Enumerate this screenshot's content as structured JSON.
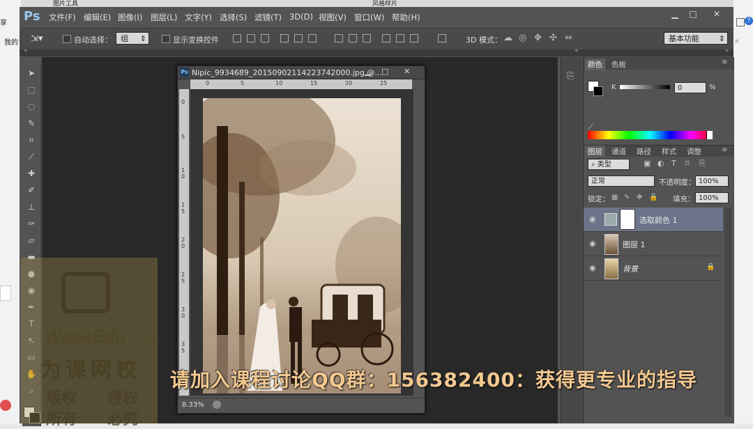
{
  "background_browser": {
    "top_label": "图片工具",
    "top_label_2": "风格样片",
    "left_labels": [
      "享",
      "我的"
    ]
  },
  "app": {
    "logo": "Ps"
  },
  "menu": [
    "文件(F)",
    "编辑(E)",
    "图像(I)",
    "图层(L)",
    "文字(Y)",
    "选择(S)",
    "滤镜(T)",
    "3D(D)",
    "视图(V)",
    "窗口(W)",
    "帮助(H)"
  ],
  "window_buttons": {
    "minimize": "▁",
    "restore": "□",
    "close": "✕"
  },
  "options": {
    "auto_select_label": "自动选择：",
    "auto_select_value": "组",
    "show_transform_label": "显示变换控件",
    "mode_3d_label": "3D 模式：",
    "workspace": "基本功能"
  },
  "document": {
    "logo": "Ps",
    "title": "Nipic_9934689_20150902114223742000.jpg @...",
    "zoom": "8.33%",
    "ruler_h": [
      "0",
      "5",
      "10",
      "15",
      "20",
      "25"
    ],
    "ruler_v": [
      "0",
      "5",
      "1\n0",
      "1\n5",
      "2\n0",
      "2\n5",
      "3\n0",
      "3\n5"
    ]
  },
  "color_panel": {
    "tabs": [
      "颜色",
      "色板"
    ],
    "channel_label": "K",
    "value": "0",
    "unit": "%"
  },
  "layers_panel": {
    "tabs": [
      "图层",
      "通道",
      "路径",
      "样式",
      "调整"
    ],
    "filter": "类型",
    "blend_mode": "正常",
    "opacity_label": "不透明度：",
    "opacity": "100%",
    "lock_label": "锁定：",
    "fill_label": "填充：",
    "fill": "100%",
    "layers": [
      {
        "name": "选取颜色 1",
        "selected": true
      },
      {
        "name": "图层 1",
        "selected": false
      },
      {
        "name": "背景",
        "selected": false
      }
    ]
  },
  "watermark": {
    "brand": "WeekEdu",
    "brand_small": ".com",
    "name": "为课网校",
    "line1_a": "版权",
    "line1_b": "侵权",
    "line2_a": "所有",
    "line2_b": "必究"
  },
  "banner": "请加入课程讨论QQ群：156382400：获得更专业的指导"
}
